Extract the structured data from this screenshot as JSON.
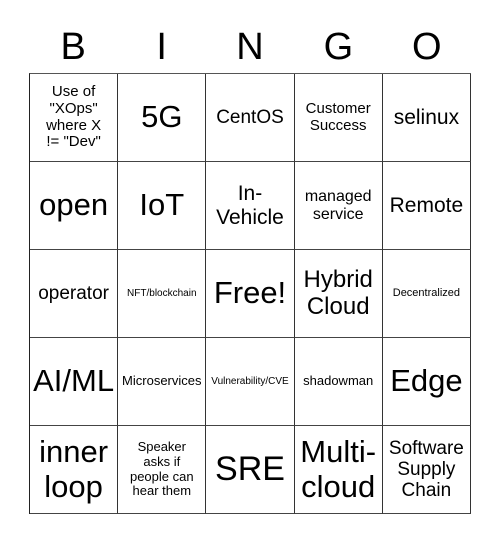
{
  "header": {
    "letters": [
      "B",
      "I",
      "N",
      "G",
      "O"
    ]
  },
  "card": {
    "rows": [
      [
        {
          "text": "Use of\n\"XOps\"\nwhere X\n!= \"Dev\"",
          "size": "s-s"
        },
        {
          "text": "5G",
          "size": "s-xl"
        },
        {
          "text": "CentOS",
          "size": "s-m"
        },
        {
          "text": "Customer\nSuccess",
          "size": "s-s"
        },
        {
          "text": "selinux",
          "size": "s-ml"
        }
      ],
      [
        {
          "text": "open",
          "size": "s-xl"
        },
        {
          "text": "IoT",
          "size": "s-xl"
        },
        {
          "text": "In-\nVehicle",
          "size": "s-ml"
        },
        {
          "text": "managed\nservice",
          "size": "s-sm"
        },
        {
          "text": "Remote",
          "size": "s-ml"
        }
      ],
      [
        {
          "text": "operator",
          "size": "s-m"
        },
        {
          "text": "NFT/blockchain",
          "size": "s-tiny"
        },
        {
          "text": "Free!",
          "size": "s-xl"
        },
        {
          "text": "Hybrid\nCloud",
          "size": "s-l"
        },
        {
          "text": "Decentralized",
          "size": "s-xxs"
        }
      ],
      [
        {
          "text": "AI/ML",
          "size": "s-xl"
        },
        {
          "text": "Microservices",
          "size": "s-xs"
        },
        {
          "text": "Vulnerability/CVE",
          "size": "s-tiny"
        },
        {
          "text": "shadowman",
          "size": "s-xs"
        },
        {
          "text": "Edge",
          "size": "s-xl"
        }
      ],
      [
        {
          "text": "inner\nloop",
          "size": "s-xl"
        },
        {
          "text": "Speaker\nasks if\npeople can\nhear them",
          "size": "s-xs"
        },
        {
          "text": "SRE",
          "size": "s-xxl"
        },
        {
          "text": "Multi-\ncloud",
          "size": "s-xl"
        },
        {
          "text": "Software\nSupply\nChain",
          "size": "s-m"
        }
      ]
    ]
  }
}
